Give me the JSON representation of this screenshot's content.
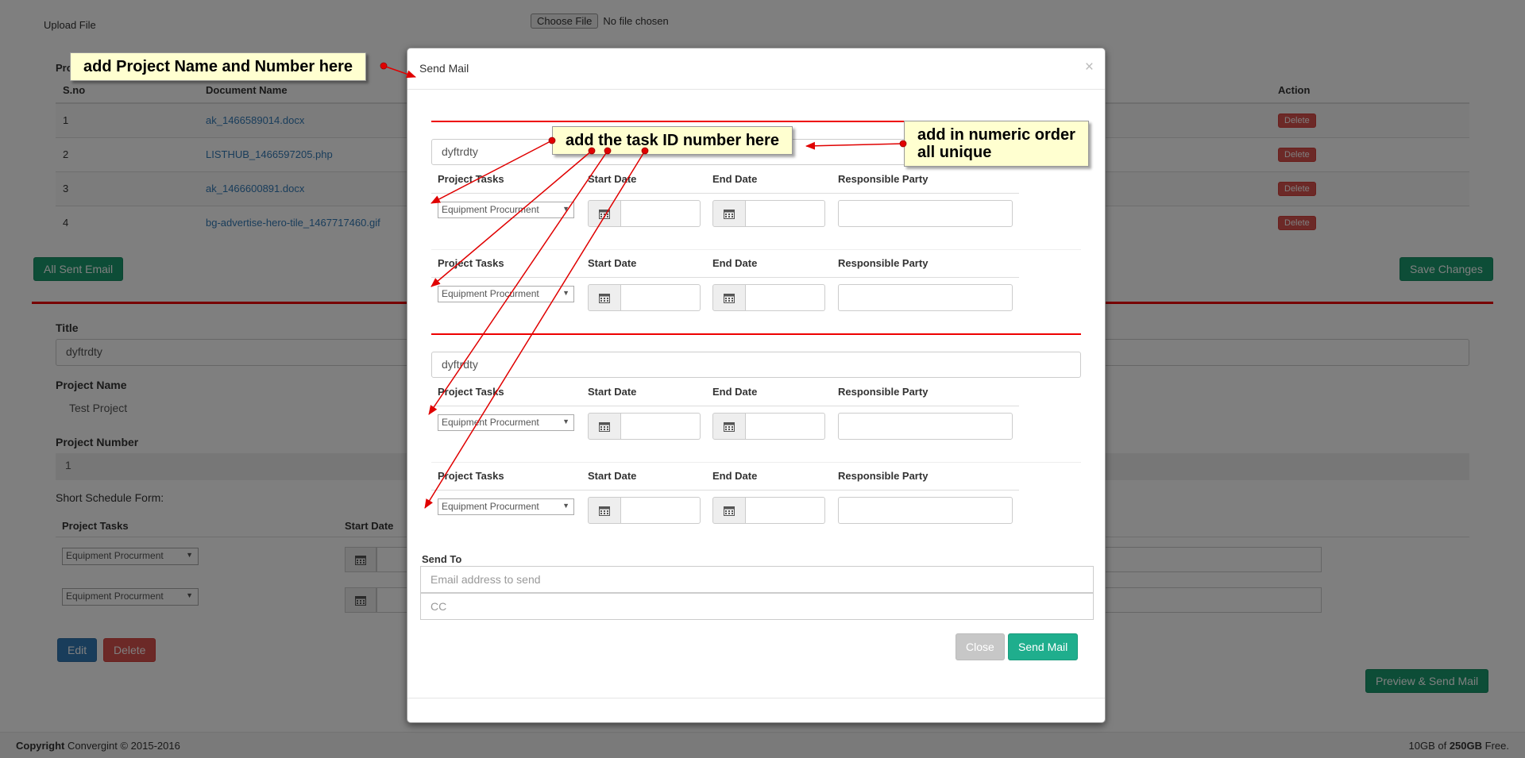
{
  "background": {
    "upload_label": "Upload File",
    "file_button": "Choose File",
    "file_status": "No file chosen",
    "docs_section_label": "Pro",
    "docs_table": {
      "headers": [
        "S.no",
        "Document Name",
        "Action"
      ],
      "rows": [
        {
          "sno": "1",
          "name": "ak_1466589014.docx",
          "action": "Delete"
        },
        {
          "sno": "2",
          "name": "LISTHUB_1466597205.php",
          "action": "Delete"
        },
        {
          "sno": "3",
          "name": "ak_1466600891.docx",
          "action": "Delete"
        },
        {
          "sno": "4",
          "name": "bg-advertise-hero-tile_1467717460.gif",
          "action": "Delete"
        }
      ]
    },
    "all_sent_email": "All Sent Email",
    "save_changes": "Save Changes",
    "title_label": "Title",
    "title_value": "dyftrdty",
    "project_name_label": "Project Name",
    "project_name_value": "Test Project",
    "project_number_label": "Project Number",
    "project_number_value": "1",
    "short_schedule_label": "Short Schedule Form:",
    "sf_col_tasks": "Project Tasks",
    "sf_col_start": "Start Date",
    "sf_select_value": "Equipment Procurment",
    "edit": "Edit",
    "delete": "Delete",
    "preview_send": "Preview & Send Mail",
    "footer_copyright_bold": "Copyright",
    "footer_copyright": "Convergint © 2015-2016",
    "footer_storage_used": "10GB of",
    "footer_storage_total": "250GB",
    "footer_storage_suffix": "Free."
  },
  "modal": {
    "title": "Send Mail",
    "close_x": "×",
    "groups": [
      {
        "title_value": "dyftrdty",
        "rows": [
          {
            "task": "Equipment Procurment"
          },
          {
            "task": "Equipment Procurment"
          }
        ]
      },
      {
        "title_value": "dyftrdty",
        "rows": [
          {
            "task": "Equipment Procurment"
          },
          {
            "task": "Equipment Procurment"
          }
        ]
      }
    ],
    "col_tasks": "Project Tasks",
    "col_start": "Start Date",
    "col_end": "End Date",
    "col_resp": "Responsible Party",
    "send_to_label": "Send To",
    "email_placeholder": "Email address to send",
    "cc_placeholder": "CC",
    "close_button": "Close",
    "send_button": "Send Mail"
  },
  "annotations": {
    "project_name": "add Project Name and Number here",
    "task_id": "add the task ID number here",
    "numeric_line1": "add in numeric order",
    "numeric_line2": "all unique"
  },
  "colors": {
    "accent_green": "#1fae8d",
    "danger_red": "#d9534f",
    "rule_red": "#ee0000",
    "callout_yellow": "#ffffd0"
  }
}
